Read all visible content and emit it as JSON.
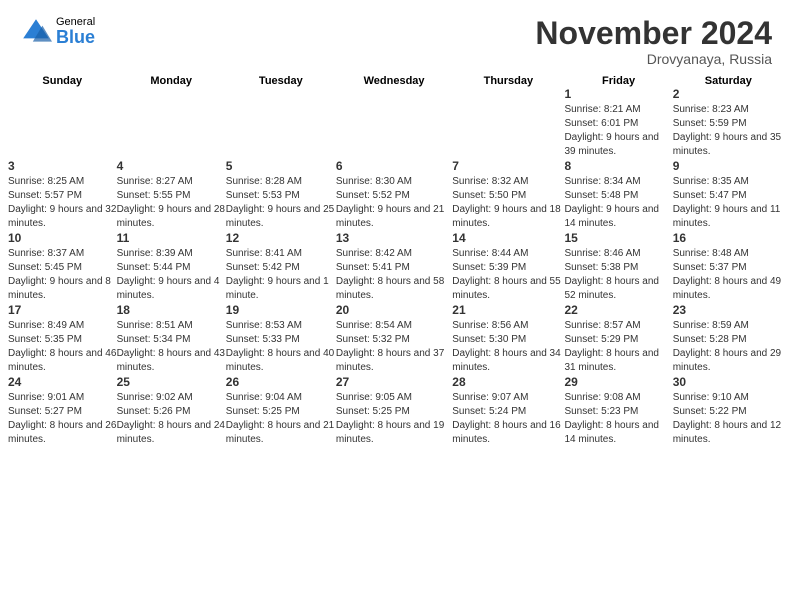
{
  "header": {
    "logo_general": "General",
    "logo_blue": "Blue",
    "month_title": "November 2024",
    "location": "Drovyanaya, Russia"
  },
  "weekdays": [
    "Sunday",
    "Monday",
    "Tuesday",
    "Wednesday",
    "Thursday",
    "Friday",
    "Saturday"
  ],
  "weeks": [
    [
      {
        "day": "",
        "info": ""
      },
      {
        "day": "",
        "info": ""
      },
      {
        "day": "",
        "info": ""
      },
      {
        "day": "",
        "info": ""
      },
      {
        "day": "",
        "info": ""
      },
      {
        "day": "1",
        "info": "Sunrise: 8:21 AM\nSunset: 6:01 PM\nDaylight: 9 hours and 39 minutes."
      },
      {
        "day": "2",
        "info": "Sunrise: 8:23 AM\nSunset: 5:59 PM\nDaylight: 9 hours and 35 minutes."
      }
    ],
    [
      {
        "day": "3",
        "info": "Sunrise: 8:25 AM\nSunset: 5:57 PM\nDaylight: 9 hours and 32 minutes."
      },
      {
        "day": "4",
        "info": "Sunrise: 8:27 AM\nSunset: 5:55 PM\nDaylight: 9 hours and 28 minutes."
      },
      {
        "day": "5",
        "info": "Sunrise: 8:28 AM\nSunset: 5:53 PM\nDaylight: 9 hours and 25 minutes."
      },
      {
        "day": "6",
        "info": "Sunrise: 8:30 AM\nSunset: 5:52 PM\nDaylight: 9 hours and 21 minutes."
      },
      {
        "day": "7",
        "info": "Sunrise: 8:32 AM\nSunset: 5:50 PM\nDaylight: 9 hours and 18 minutes."
      },
      {
        "day": "8",
        "info": "Sunrise: 8:34 AM\nSunset: 5:48 PM\nDaylight: 9 hours and 14 minutes."
      },
      {
        "day": "9",
        "info": "Sunrise: 8:35 AM\nSunset: 5:47 PM\nDaylight: 9 hours and 11 minutes."
      }
    ],
    [
      {
        "day": "10",
        "info": "Sunrise: 8:37 AM\nSunset: 5:45 PM\nDaylight: 9 hours and 8 minutes."
      },
      {
        "day": "11",
        "info": "Sunrise: 8:39 AM\nSunset: 5:44 PM\nDaylight: 9 hours and 4 minutes."
      },
      {
        "day": "12",
        "info": "Sunrise: 8:41 AM\nSunset: 5:42 PM\nDaylight: 9 hours and 1 minute."
      },
      {
        "day": "13",
        "info": "Sunrise: 8:42 AM\nSunset: 5:41 PM\nDaylight: 8 hours and 58 minutes."
      },
      {
        "day": "14",
        "info": "Sunrise: 8:44 AM\nSunset: 5:39 PM\nDaylight: 8 hours and 55 minutes."
      },
      {
        "day": "15",
        "info": "Sunrise: 8:46 AM\nSunset: 5:38 PM\nDaylight: 8 hours and 52 minutes."
      },
      {
        "day": "16",
        "info": "Sunrise: 8:48 AM\nSunset: 5:37 PM\nDaylight: 8 hours and 49 minutes."
      }
    ],
    [
      {
        "day": "17",
        "info": "Sunrise: 8:49 AM\nSunset: 5:35 PM\nDaylight: 8 hours and 46 minutes."
      },
      {
        "day": "18",
        "info": "Sunrise: 8:51 AM\nSunset: 5:34 PM\nDaylight: 8 hours and 43 minutes."
      },
      {
        "day": "19",
        "info": "Sunrise: 8:53 AM\nSunset: 5:33 PM\nDaylight: 8 hours and 40 minutes."
      },
      {
        "day": "20",
        "info": "Sunrise: 8:54 AM\nSunset: 5:32 PM\nDaylight: 8 hours and 37 minutes."
      },
      {
        "day": "21",
        "info": "Sunrise: 8:56 AM\nSunset: 5:30 PM\nDaylight: 8 hours and 34 minutes."
      },
      {
        "day": "22",
        "info": "Sunrise: 8:57 AM\nSunset: 5:29 PM\nDaylight: 8 hours and 31 minutes."
      },
      {
        "day": "23",
        "info": "Sunrise: 8:59 AM\nSunset: 5:28 PM\nDaylight: 8 hours and 29 minutes."
      }
    ],
    [
      {
        "day": "24",
        "info": "Sunrise: 9:01 AM\nSunset: 5:27 PM\nDaylight: 8 hours and 26 minutes."
      },
      {
        "day": "25",
        "info": "Sunrise: 9:02 AM\nSunset: 5:26 PM\nDaylight: 8 hours and 24 minutes."
      },
      {
        "day": "26",
        "info": "Sunrise: 9:04 AM\nSunset: 5:25 PM\nDaylight: 8 hours and 21 minutes."
      },
      {
        "day": "27",
        "info": "Sunrise: 9:05 AM\nSunset: 5:25 PM\nDaylight: 8 hours and 19 minutes."
      },
      {
        "day": "28",
        "info": "Sunrise: 9:07 AM\nSunset: 5:24 PM\nDaylight: 8 hours and 16 minutes."
      },
      {
        "day": "29",
        "info": "Sunrise: 9:08 AM\nSunset: 5:23 PM\nDaylight: 8 hours and 14 minutes."
      },
      {
        "day": "30",
        "info": "Sunrise: 9:10 AM\nSunset: 5:22 PM\nDaylight: 8 hours and 12 minutes."
      }
    ]
  ]
}
